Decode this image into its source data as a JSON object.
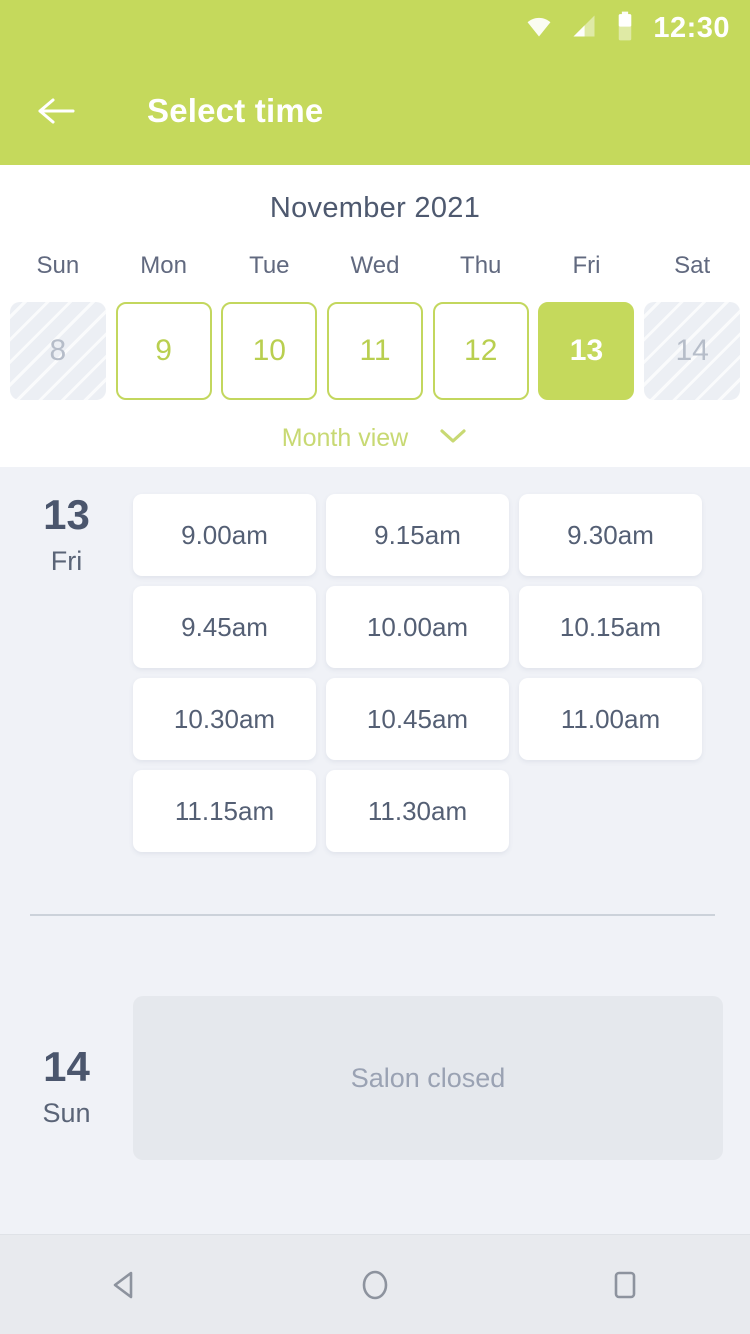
{
  "statusbar": {
    "time": "12:30",
    "icons": [
      "wifi-icon",
      "cellular-signal-icon",
      "battery-icon"
    ]
  },
  "appbar": {
    "title": "Select time",
    "back_icon": "back-arrow-icon"
  },
  "calendar": {
    "month_title": "November 2021",
    "days_of_week": [
      "Sun",
      "Mon",
      "Tue",
      "Wed",
      "Thu",
      "Fri",
      "Sat"
    ],
    "dates": [
      {
        "num": "8",
        "state": "disabled"
      },
      {
        "num": "9",
        "state": "available"
      },
      {
        "num": "10",
        "state": "available"
      },
      {
        "num": "11",
        "state": "available"
      },
      {
        "num": "12",
        "state": "available"
      },
      {
        "num": "13",
        "state": "selected"
      },
      {
        "num": "14",
        "state": "disabled"
      }
    ],
    "month_view_label": "Month view",
    "month_view_icon": "chevron-down-icon"
  },
  "schedule": {
    "days": [
      {
        "day_num": "13",
        "day_dow": "Fri",
        "slots": [
          "9.00am",
          "9.15am",
          "9.30am",
          "9.45am",
          "10.00am",
          "10.15am",
          "10.30am",
          "10.45am",
          "11.00am",
          "11.15am",
          "11.30am"
        ]
      },
      {
        "day_num": "14",
        "day_dow": "Sun",
        "closed_label": "Salon closed"
      }
    ]
  },
  "navbar": {
    "back_icon": "android-back-icon",
    "home_icon": "android-home-icon",
    "recents_icon": "android-recents-icon"
  },
  "colors": {
    "brand_green": "#c5d95c",
    "slot_bg": "#ffffff",
    "page_bg": "#f0f2f7",
    "text_dark": "#4b566d",
    "text_muted": "#9aa2b3"
  }
}
